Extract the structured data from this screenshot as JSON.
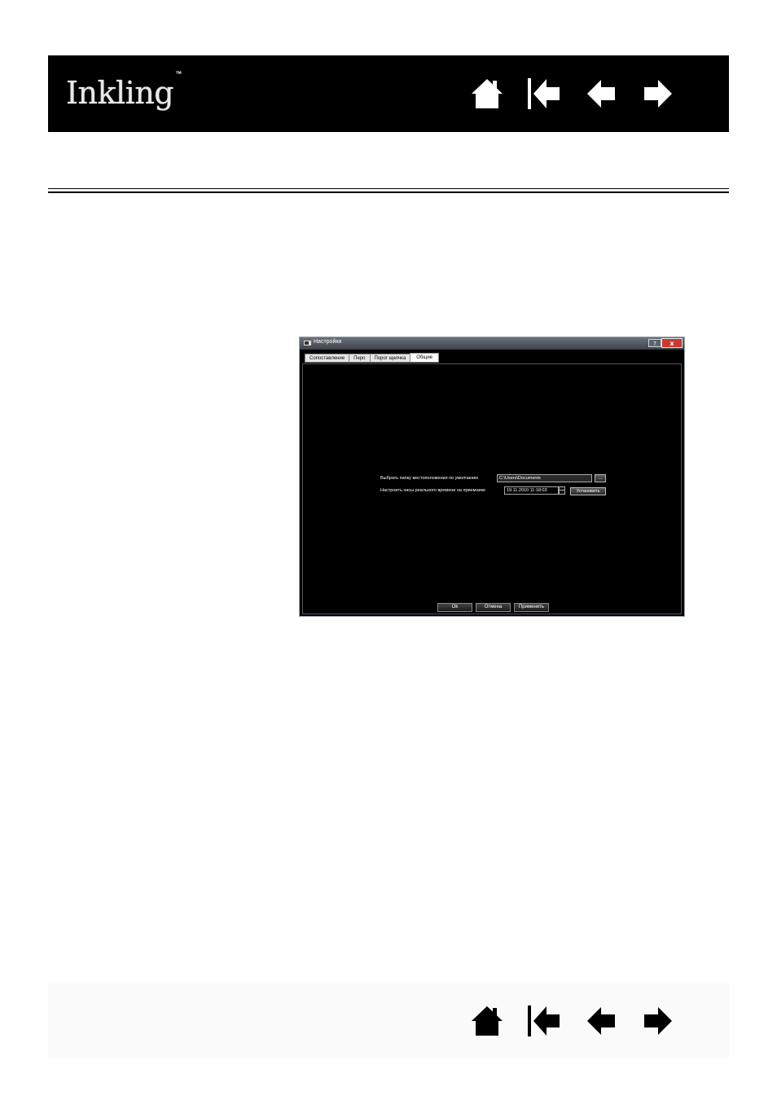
{
  "header": {
    "logo_text": "Inkling",
    "logo_tm": "™"
  },
  "nav_icons": [
    "home-icon",
    "first-page-icon",
    "previous-page-icon",
    "next-page-icon"
  ],
  "dialog": {
    "title": "Настройки",
    "help_label": "?",
    "close_label": "x",
    "tabs": [
      {
        "label": "Сопоставление",
        "active": false
      },
      {
        "label": "Перо",
        "active": false
      },
      {
        "label": "Порог щелчка",
        "active": false
      },
      {
        "label": "Общие",
        "active": true
      }
    ],
    "folder_label": "Выбрать папку местоположения по умолчанию",
    "folder_value": "C:\\Users\\Documents",
    "browse_label": "...",
    "clock_label": "Настроить часы реального времени на приемнике",
    "clock_value": "19.11.2010 11:18:03",
    "set_label": "Установить",
    "ok_label": "Ok",
    "cancel_label": "Отмена",
    "apply_label": "Применить"
  },
  "colors": {
    "header_bg": "#000000",
    "dialog_bg": "#000000",
    "titlebar": "#4b525a",
    "close_red": "#c8392e"
  }
}
